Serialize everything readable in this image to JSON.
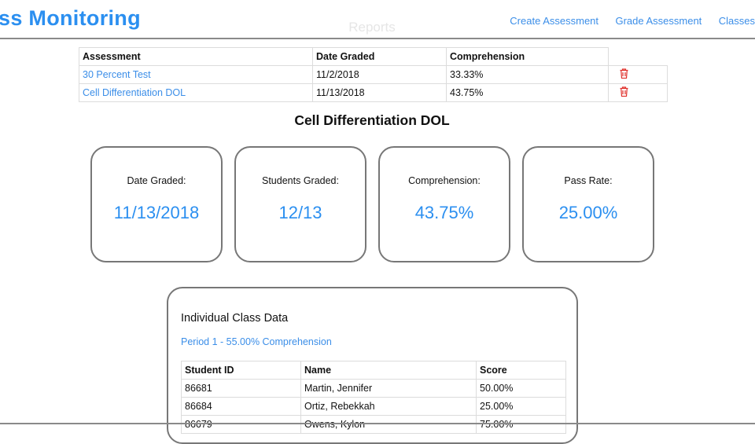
{
  "navbar": {
    "brand": "ss Monitoring",
    "links": [
      "Create Assessment",
      "Grade Assessment",
      "Classes"
    ]
  },
  "page_title": "Reports",
  "reports_table": {
    "headers": [
      "Assessment",
      "Date Graded",
      "Comprehension"
    ],
    "rows": [
      {
        "assessment": "30 Percent Test",
        "date_graded": "11/2/2018",
        "comprehension": "33.33%"
      },
      {
        "assessment": "Cell Differentiation DOL",
        "date_graded": "11/13/2018",
        "comprehension": "43.75%"
      }
    ],
    "delete_icon": "trash-icon"
  },
  "detail": {
    "title": "Cell Differentiation DOL",
    "cards": [
      {
        "label": "Date Graded:",
        "value": "11/13/2018"
      },
      {
        "label": "Students Graded:",
        "value": "12/13"
      },
      {
        "label": "Comprehension:",
        "value": "43.75%"
      },
      {
        "label": "Pass Rate:",
        "value": "25.00%"
      }
    ]
  },
  "class_data": {
    "title": "Individual Class Data",
    "period": "Period 1 - 55.00% Comprehension",
    "headers": [
      "Student ID",
      "Name",
      "Score"
    ],
    "rows": [
      {
        "id": "86681",
        "name": "Martin, Jennifer",
        "score": "50.00%"
      },
      {
        "id": "86684",
        "name": "Ortiz, Rebekkah",
        "score": "25.00%"
      },
      {
        "id": "86679",
        "name": "Owens, Kylon",
        "score": "75.00%"
      }
    ]
  },
  "colors": {
    "accent": "#2b8ff0",
    "link": "#3b8ee8",
    "delete": "#e0302b",
    "card_border": "#777777"
  }
}
